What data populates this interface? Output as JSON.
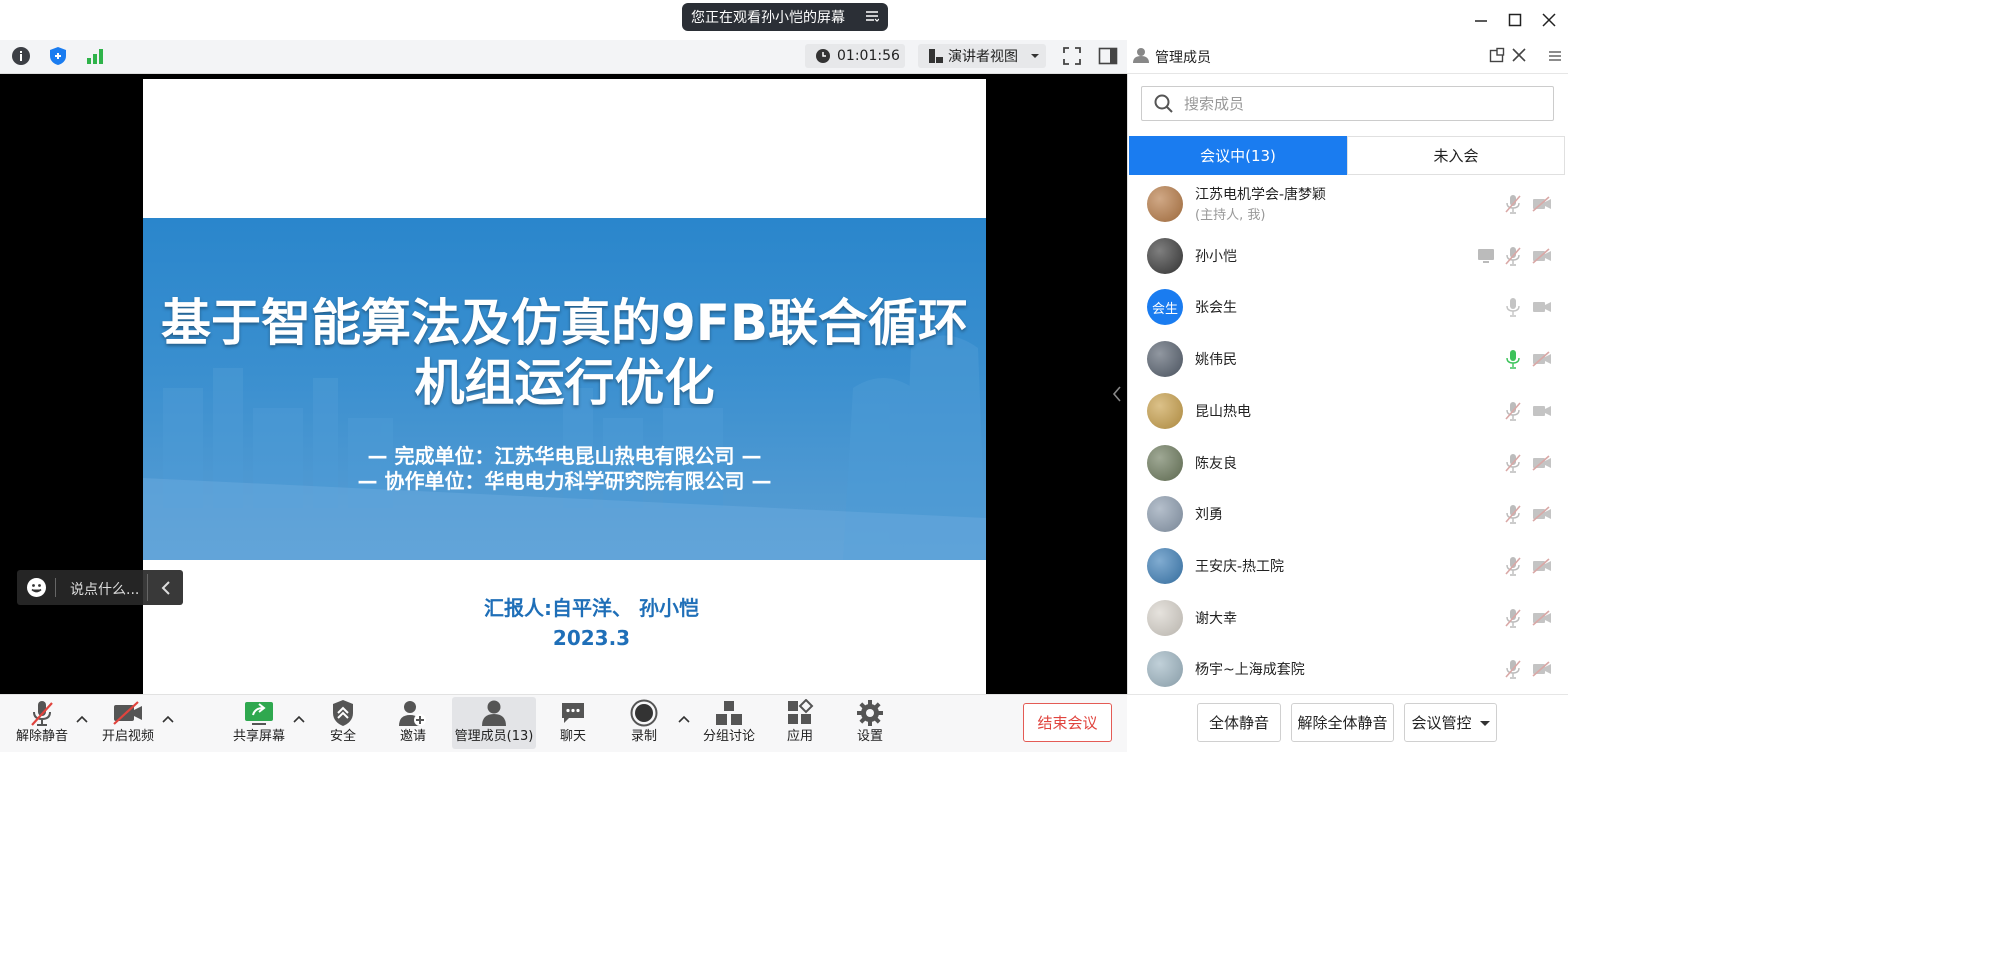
{
  "share_banner": "您正在观看孙小恺的屏幕",
  "toolbar": {
    "timer": "01:01:56",
    "view_mode": "演讲者视图"
  },
  "slide": {
    "title_line1": "基于智能算法及仿真的9FB联合循环",
    "title_line2": "机组运行优化",
    "unit_line": "— 完成单位：江苏华电昆山热电有限公司 —",
    "coop_line": "— 协作单位：华电电力科学研究院有限公司 —",
    "reporter": "汇报人:自平洋、  孙小恺",
    "date": "2023.3"
  },
  "chat_placeholder": "说点什么...",
  "bottom_bar": {
    "unmute": "解除静音",
    "start_video": "开启视频",
    "share_screen": "共享屏幕",
    "security": "安全",
    "invite": "邀请",
    "manage_members": "管理成员(13)",
    "chat": "聊天",
    "record": "录制",
    "breakout": "分组讨论",
    "apps": "应用",
    "settings": "设置",
    "end_meeting": "结束会议"
  },
  "panel": {
    "title": "管理成员",
    "search_placeholder": "搜索成员",
    "tab_in_meeting": "会议中(13)",
    "tab_not_joined": "未入会",
    "members": [
      {
        "name": "江苏电机学会-唐梦颖",
        "sub": "(主持人, 我)",
        "avatar_text": "",
        "avatar_color": "#b77a45",
        "mic": "muted",
        "cam": "off"
      },
      {
        "name": "孙小恺",
        "sub": "",
        "avatar_text": "",
        "avatar_color": "#3a3a3a",
        "mic": "muted",
        "cam": "off",
        "sharing": true
      },
      {
        "name": "张会生",
        "sub": "",
        "avatar_text": "会生",
        "avatar_color": "#1a7cf0",
        "mic": "idle",
        "cam": "idle"
      },
      {
        "name": "姚伟民",
        "sub": "",
        "avatar_text": "",
        "avatar_color": "#56606e",
        "mic": "speaking",
        "cam": "off"
      },
      {
        "name": "昆山热电",
        "sub": "",
        "avatar_text": "",
        "avatar_color": "#c9a04a",
        "mic": "muted",
        "cam": "idle"
      },
      {
        "name": "陈友良",
        "sub": "",
        "avatar_text": "",
        "avatar_color": "#6c7a5c",
        "mic": "muted",
        "cam": "off"
      },
      {
        "name": "刘勇",
        "sub": "",
        "avatar_text": "",
        "avatar_color": "#8d9db0",
        "mic": "muted",
        "cam": "off"
      },
      {
        "name": "王安庆-热工院",
        "sub": "",
        "avatar_text": "",
        "avatar_color": "#3d7fb8",
        "mic": "muted",
        "cam": "off"
      },
      {
        "name": "谢大幸",
        "sub": "",
        "avatar_text": "",
        "avatar_color": "#d8d3cb",
        "mic": "muted",
        "cam": "off"
      },
      {
        "name": "杨宇~上海成套院",
        "sub": "",
        "avatar_text": "",
        "avatar_color": "#9fb7c4",
        "mic": "muted",
        "cam": "off"
      }
    ],
    "footer": {
      "mute_all": "全体静音",
      "unmute_all": "解除全体静音",
      "meeting_control": "会议管控"
    }
  },
  "colors": {
    "accent": "#1a7cf0",
    "danger": "#e0443e",
    "muted_icon": "#d9a8a6",
    "speaking": "#3cc35a"
  }
}
